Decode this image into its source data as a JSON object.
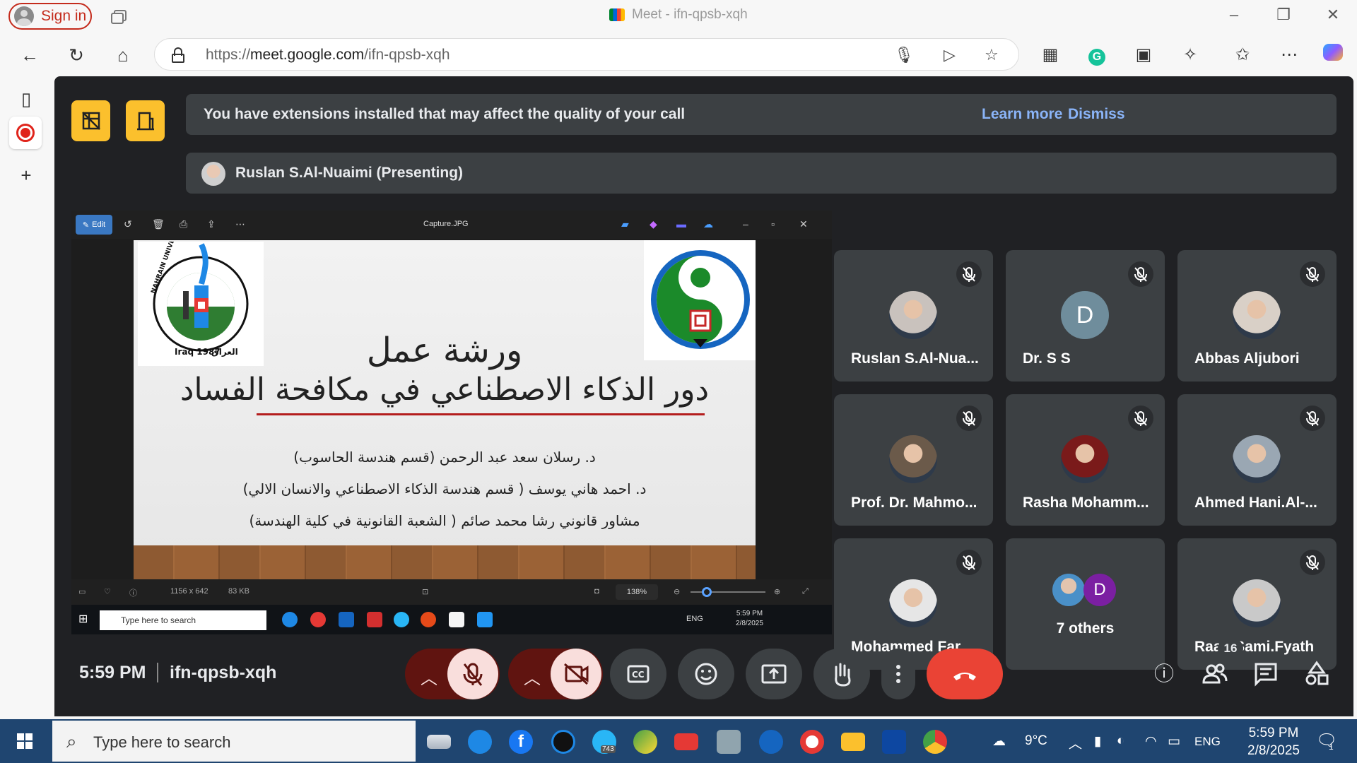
{
  "browser": {
    "sign_in": "Sign in",
    "window_title": "Meet - ifn-qpsb-xqh",
    "url_prefix": "https://",
    "url_host": "meet.google.com",
    "url_path": "/ifn-qpsb-xqh"
  },
  "meet": {
    "extension_warning": "You have extensions installed that may affect the quality of your call",
    "learn_more": "Learn more",
    "dismiss": "Dismiss",
    "presenter": "Ruslan S.Al-Nuaimi (Presenting)",
    "time": "5:59 PM",
    "meeting_code": "ifn-qpsb-xqh",
    "participant_count": "16",
    "colors": {
      "accent_yellow": "#fbc02d",
      "end_call": "#ea4335",
      "bg": "#202124",
      "tile": "#3c4043",
      "link": "#8ab4f8"
    }
  },
  "shared_screen": {
    "viewer": {
      "edit_label": "Edit",
      "file_name": "Capture.JPG",
      "dimensions": "1156 x 642",
      "file_size": "83 KB",
      "zoom": "138%"
    },
    "slide": {
      "title_line1": "ورشة عمل",
      "title_line2": "دور الذكاء الاصطناعي في مكافحة الفساد",
      "line1": "د. رسلان سعد عبد الرحمن (قسم هندسة الحاسوب)",
      "line2": "د. احمد هاني يوسف ( قسم هندسة الذكاء الاصطناعي والانسان الالي)",
      "line3": "مشاور قانوني رشا محمد صائم ( الشعبة القانونية في كلية الهندسة)",
      "logo_left_text_en": "NAHRAIN UNIVERSITY",
      "logo_left_year": "Iraq 1987",
      "logo_left_text_ar": "العراق"
    },
    "inner_taskbar": {
      "search": "Type here to search",
      "lang": "ENG",
      "time": "5:59 PM",
      "date": "2/8/2025"
    }
  },
  "participants": [
    {
      "name": "Ruslan S.Al-Nua...",
      "avatar": "photo",
      "color": "#c9c2bd"
    },
    {
      "name": "Dr. S S",
      "avatar": "letter",
      "letter": "D",
      "color": "#6f8d9c"
    },
    {
      "name": "Abbas Aljubori",
      "avatar": "photo",
      "color": "#d9d0c7"
    },
    {
      "name": "Prof. Dr. Mahmo...",
      "avatar": "photo",
      "color": "#6b5a4a"
    },
    {
      "name": "Rasha Mohamm...",
      "avatar": "photo",
      "color": "#7a1a1a"
    },
    {
      "name": "Ahmed Hani.Al-...",
      "avatar": "photo",
      "color": "#9aa7b3"
    },
    {
      "name": "Mohammed Far...",
      "avatar": "photo",
      "color": "#e6e6e6"
    },
    {
      "name": "7 others",
      "avatar": "group",
      "letter": "D",
      "color": "#7b1fa2"
    },
    {
      "name": "Raad Sami.Fyath",
      "avatar": "photo",
      "color": "#c9c9c9"
    }
  ],
  "taskbar": {
    "search": "Type here to search",
    "telegram_badge": "743",
    "weather": "9°C",
    "lang": "ENG",
    "time": "5:59 PM",
    "date": "2/8/2025",
    "notif_count": "1"
  }
}
